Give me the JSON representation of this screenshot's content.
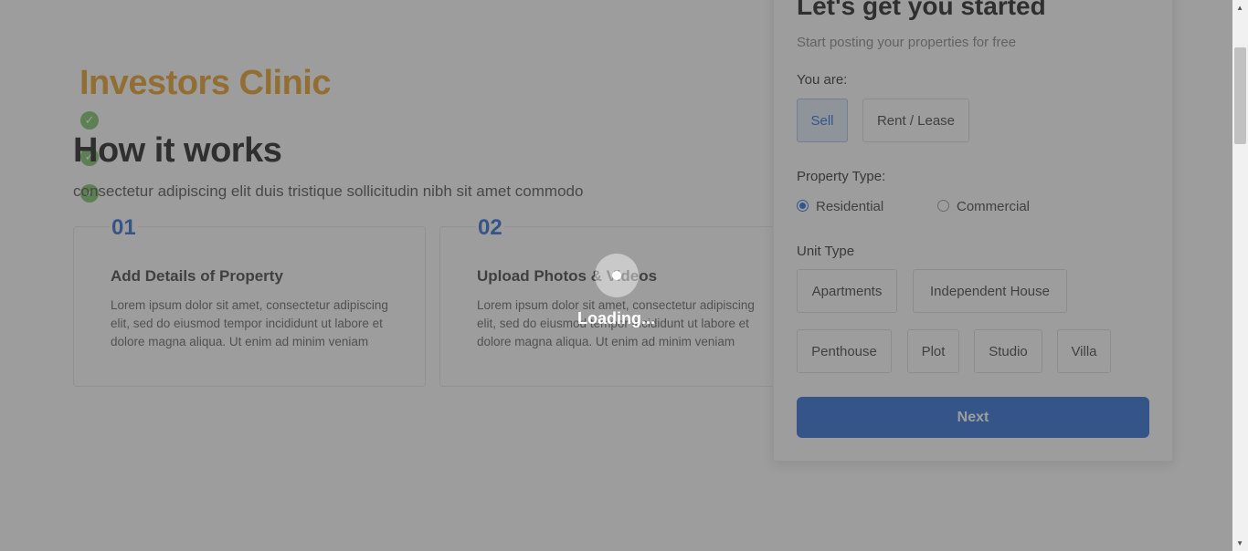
{
  "brand": "Investors Clinic",
  "how": {
    "title": "How it works",
    "subtitle": "consectetur adipiscing elit duis tristique sollicitudin nibh sit amet commodo",
    "steps": [
      {
        "num": "01",
        "title": "Add Details of Property",
        "text": "Lorem ipsum dolor sit amet, consectetur adipiscing elit, sed do eiusmod tempor incididunt ut labore et dolore magna aliqua. Ut enim ad minim veniam"
      },
      {
        "num": "02",
        "title": "Upload Photos & Videos",
        "text": "Lorem ipsum dolor sit amet, consectetur adipiscing elit, sed do eiusmod tempor incididunt ut labore et dolore magna aliqua. Ut enim ad minim veniam"
      }
    ]
  },
  "form": {
    "title": "Let's get you started",
    "subtitle": "Start posting your properties for free",
    "you_are_label": "You are:",
    "you_are_options": [
      "Sell",
      "Rent / Lease"
    ],
    "you_are_selected": "Sell",
    "property_type_label": "Property Type:",
    "property_types": [
      "Residential",
      "Commercial"
    ],
    "property_type_selected": "Residential",
    "unit_type_label": "Unit Type",
    "unit_types": [
      "Apartments",
      "Independent House",
      "Penthouse",
      "Plot",
      "Studio",
      "Villa"
    ],
    "next_label": "Next"
  },
  "overlay": {
    "loading_text": "Loading..."
  },
  "colors": {
    "brand": "#e8a12b",
    "accent": "#2e6fd6",
    "check": "#7dc36a"
  }
}
